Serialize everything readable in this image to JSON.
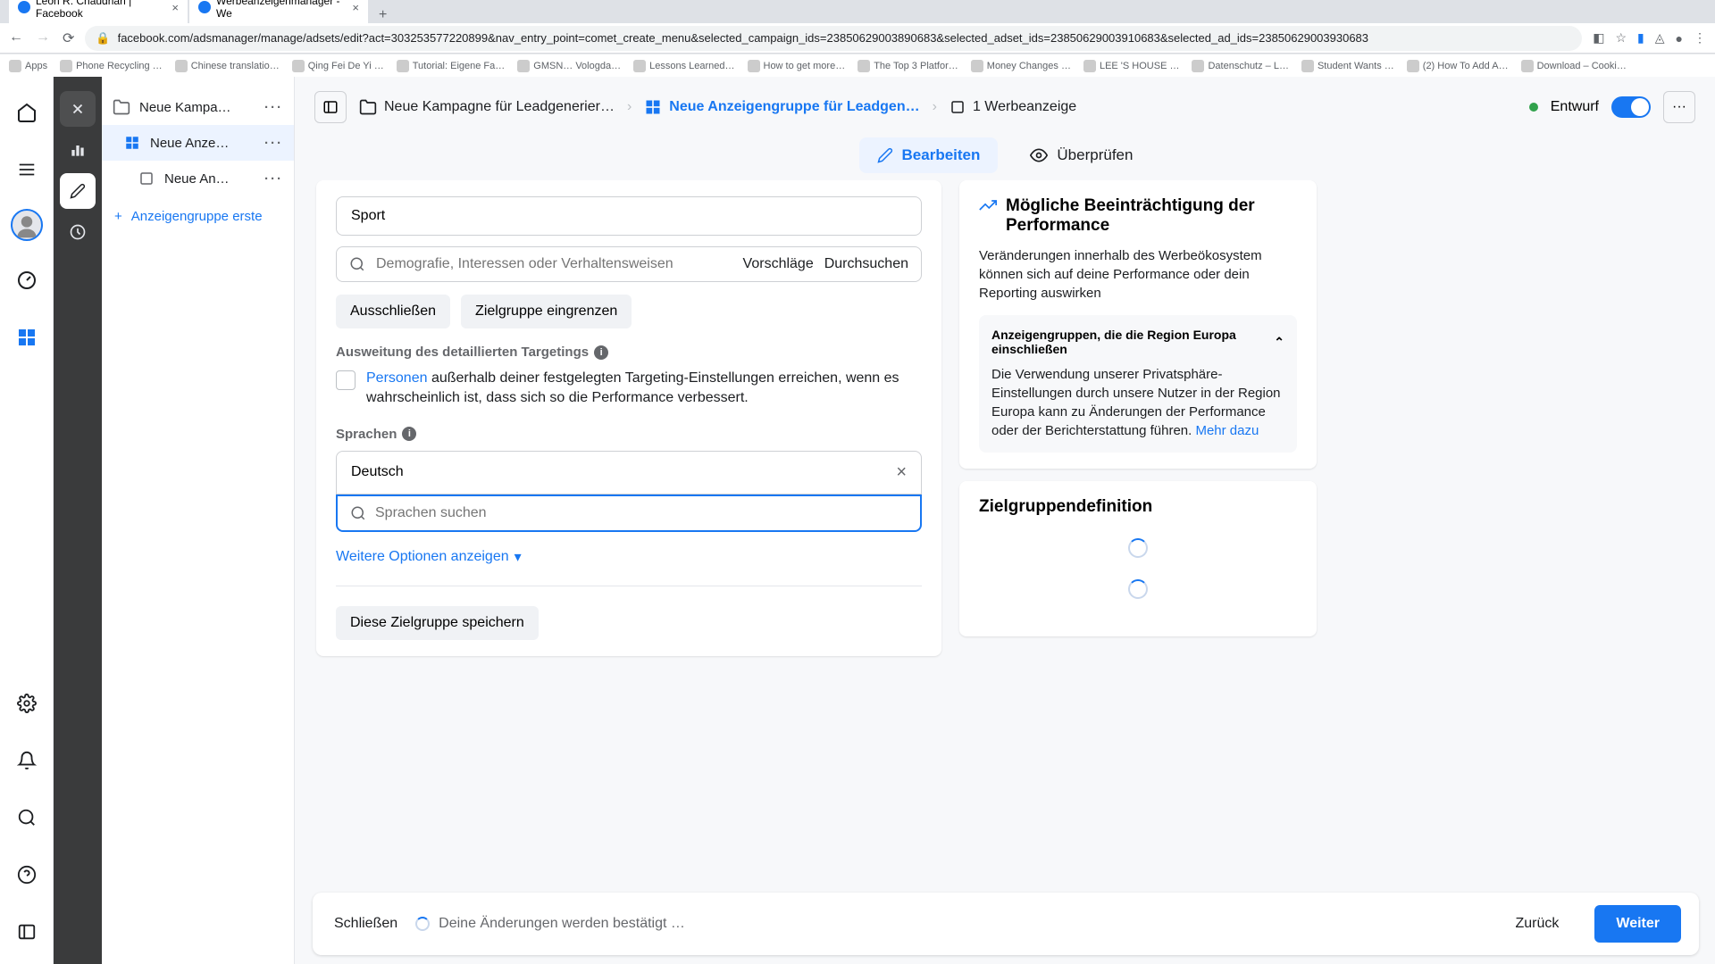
{
  "browser": {
    "tabs": [
      {
        "label": "Leon R. Chaudhari | Facebook"
      },
      {
        "label": "Werbeanzeigenmanager - We"
      }
    ],
    "url": "facebook.com/adsmanager/manage/adsets/edit?act=303253577220899&nav_entry_point=comet_create_menu&selected_campaign_ids=23850629003890683&selected_adset_ids=23850629003910683&selected_ad_ids=23850629003930683",
    "bookmarks": [
      "Apps",
      "Phone Recycling …",
      "Chinese translatio…",
      "Qing Fei De Yi …",
      "Tutorial: Eigene Fa…",
      "GMSN… Vologda…",
      "Lessons Learned…",
      "How to get more…",
      "The Top 3 Platfor…",
      "Money Changes …",
      "LEE 'S HOUSE …",
      "Datenschutz – L…",
      "Student Wants …",
      "(2) How To Add A…",
      "Download – Cooki…"
    ]
  },
  "tree": {
    "campaign": "Neue Kampa…",
    "adset": "Neue Anze…",
    "ad": "Neue An…",
    "create": "Anzeigengruppe erste"
  },
  "crumbs": {
    "c1": "Neue Kampagne für Leadgenerier…",
    "c2": "Neue Anzeigengruppe für Leadgen…",
    "c3": "1 Werbeanzeige",
    "status": "Entwurf"
  },
  "tabs": {
    "edit": "Bearbeiten",
    "review": "Überprüfen"
  },
  "form": {
    "interest_tag": "Sport",
    "search_placeholder": "Demografie, Interessen oder Verhaltensweisen",
    "suggestions": "Vorschläge",
    "browse": "Durchsuchen",
    "exclude": "Ausschließen",
    "narrow": "Zielgruppe eingrenzen",
    "expansion_label": "Ausweitung des detaillierten Targetings",
    "expansion_text_link": "Personen",
    "expansion_text_rest": " außerhalb deiner festgelegten Targeting-Einstellungen erreichen, wenn es wahrscheinlich ist, dass sich so die Performance verbessert.",
    "languages_label": "Sprachen",
    "lang_value": "Deutsch",
    "lang_search_placeholder": "Sprachen suchen",
    "more_opts": "Weitere Optionen anzeigen",
    "save_audience": "Diese Zielgruppe speichern"
  },
  "side": {
    "perf_title": "Mögliche Beeinträchtigung der Performance",
    "perf_text": "Veränderungen innerhalb des Werbeökosystem können sich auf deine Performance oder dein Reporting auswirken",
    "panel_title": "Anzeigengruppen, die die Region Europa einschließen",
    "panel_text": "Die Verwendung unserer Privatsphäre-Einstellungen durch unsere Nutzer in der Region Europa kann zu Änderungen der Performance oder der Berichterstattung führen. ",
    "panel_link": "Mehr dazu",
    "aud_title": "Zielgruppendefinition"
  },
  "footer": {
    "close": "Schließen",
    "saving": "Deine Änderungen werden bestätigt …",
    "back": "Zurück",
    "next": "Weiter"
  }
}
